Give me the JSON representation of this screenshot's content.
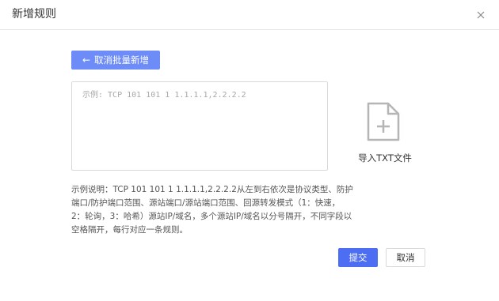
{
  "dialog": {
    "title": "新增规则",
    "close_icon": "close-icon"
  },
  "back_button": {
    "icon": "arrow-left-icon",
    "arrow_glyph": "←",
    "label": "取消批量新增"
  },
  "rules_input": {
    "value": "",
    "placeholder": "示例: TCP 101 101 1 1.1.1.1,2.2.2.2"
  },
  "import": {
    "icon": "file-add-icon",
    "label": "导入TXT文件"
  },
  "description": "示例说明：TCP 101 101 1 1.1.1.1,2.2.2.2从左到右依次是协议类型、防护端口/防护端口范围、源站端口/源站端口范围、回源转发模式（1：快速，2：轮询，3：哈希）源站IP/域名，多个源站IP/域名以分号隔开，不同字段以空格隔开，每行对应一条规则。",
  "footer": {
    "submit_label": "提交",
    "cancel_label": "取消"
  },
  "colors": {
    "primary": "#4d6ef2",
    "primary_light": "#6d8cf7",
    "border": "#d9d9d9",
    "icon_gray": "#b5b5b5"
  }
}
